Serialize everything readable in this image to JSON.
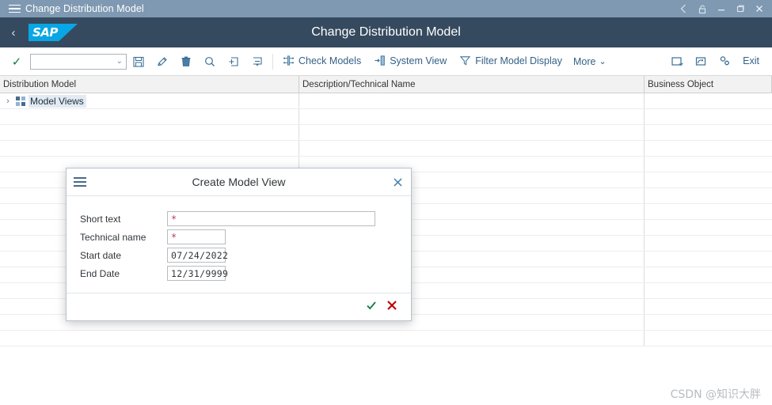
{
  "os_window": {
    "title": "Change Distribution Model",
    "menu_icon": "hamburger-icon",
    "controls": [
      {
        "name": "back-icon",
        "glyph": "‹"
      },
      {
        "name": "unlock-icon",
        "glyph": "⚿"
      },
      {
        "name": "minimize-icon",
        "glyph": "—"
      },
      {
        "name": "restore-icon",
        "glyph": "❐"
      },
      {
        "name": "close-icon",
        "glyph": "✕"
      }
    ]
  },
  "shell": {
    "back_glyph": "‹",
    "logo_text": "SAP",
    "title": "Change Distribution Model"
  },
  "toolbar": {
    "confirm_glyph": "✓",
    "combo_value": "",
    "combo_placeholder": "",
    "combo_caret": "⌄",
    "icon_buttons": [
      {
        "name": "save-icon",
        "title": "Save"
      },
      {
        "name": "edit-pencil-icon",
        "title": "Change"
      },
      {
        "name": "delete-trash-icon",
        "title": "Delete"
      },
      {
        "name": "find-icon",
        "title": "Find"
      },
      {
        "name": "expand-node-icon",
        "title": "Expand"
      },
      {
        "name": "collapse-node-icon",
        "title": "Collapse"
      }
    ],
    "actions": [
      {
        "name": "check-models",
        "label": "Check Models",
        "icon": "check-models-icon"
      },
      {
        "name": "system-view",
        "label": "System View",
        "icon": "system-view-icon"
      },
      {
        "name": "filter-model-display",
        "label": "Filter Model Display",
        "icon": "filter-icon"
      }
    ],
    "more_label": "More",
    "more_caret": "⌄",
    "right_icons": [
      {
        "name": "new-window-icon"
      },
      {
        "name": "open-window-icon"
      },
      {
        "name": "customize-icon"
      }
    ],
    "exit_label": "Exit"
  },
  "grid": {
    "columns": [
      {
        "name": "distribution-model",
        "label": "Distribution Model"
      },
      {
        "name": "description-technical-name",
        "label": "Description/Technical Name"
      },
      {
        "name": "business-object",
        "label": "Business Object"
      }
    ],
    "tree": {
      "expand_arrow": "›",
      "node_icon": "model-views-icon",
      "label": "Model Views"
    },
    "empty_row_count": 15
  },
  "hscrollbar": {
    "left_glyph": "‹›",
    "right_glyph": "‹›",
    "thumb_percent": 88
  },
  "dialog": {
    "menu_icon": "hamburger-icon",
    "title": "Create Model View",
    "close_glyph": "✕",
    "required_marker": "*",
    "fields": [
      {
        "name": "short-text",
        "label": "Short text",
        "value": "",
        "required": true,
        "size": "wide"
      },
      {
        "name": "technical-name",
        "label": "Technical name",
        "value": "",
        "required": true,
        "size": "mid"
      },
      {
        "name": "start-date",
        "label": "Start date",
        "value": "07/24/2022",
        "required": false,
        "size": "date"
      },
      {
        "name": "end-date",
        "label": "End Date",
        "value": "12/31/9999",
        "required": false,
        "size": "date"
      }
    ],
    "confirm_glyph": "✓",
    "cancel_glyph": "✕"
  },
  "watermark": {
    "text": "CSDN @知识大胖"
  },
  "colors": {
    "os_titlebar": "#7f99b2",
    "shell": "#354a5f",
    "sap_logo": "#08a6e4",
    "accent_link": "#346187",
    "success": "#107e3e",
    "error": "#bb0000",
    "required": "#b5405a"
  }
}
